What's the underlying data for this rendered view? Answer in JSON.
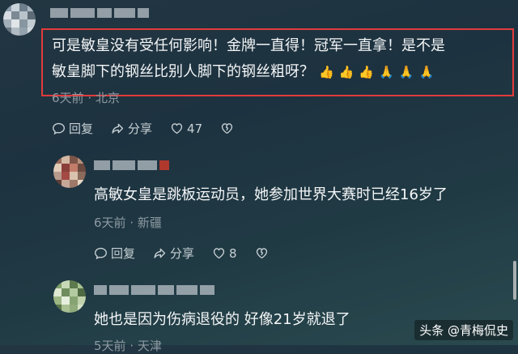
{
  "comments": [
    {
      "text_line1": "可是敏皇没有受任何影响！金牌一直得！冠军一直拿！是不是",
      "text_line2": "敏皇脚下的钢丝比别人脚下的钢丝粗呀？",
      "emojis": [
        "👍",
        "👍",
        "👍",
        "🙏",
        "🙏",
        "🙏"
      ],
      "time": "6天前",
      "location": "北京",
      "reply_label": "回复",
      "share_label": "分享",
      "likes": "47"
    },
    {
      "text": "高敏女皇是跳板运动员，她参加世界大赛时已经16岁了",
      "time": "6天前",
      "location": "新疆",
      "reply_label": "回复",
      "share_label": "分享",
      "likes": "8"
    },
    {
      "text": "她也是因为伤病退役的 好像21岁就退了",
      "time": "5天前",
      "location": "天津"
    }
  ],
  "watermark": "头条 @青梅侃史",
  "colors": {
    "highlight": "#e23b3b",
    "background": "#223642"
  }
}
